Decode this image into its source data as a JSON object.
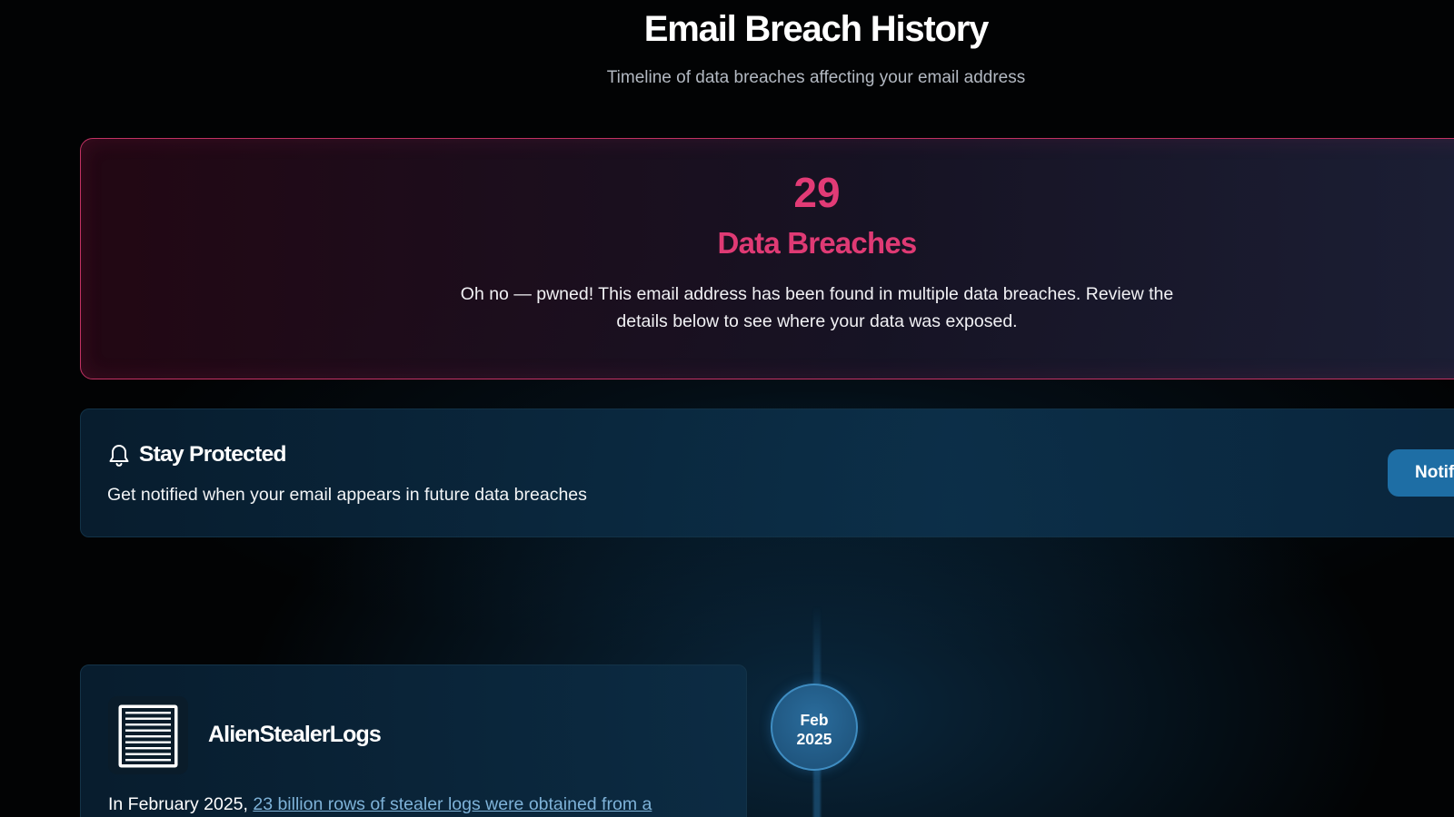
{
  "header": {
    "title": "Email Breach History",
    "subtitle": "Timeline of data breaches affecting your email address"
  },
  "summary": {
    "count": "29",
    "label": "Data Breaches",
    "text": "Oh no — pwned! This email address has been found in multiple data breaches. Review the details below to see where your data was exposed.",
    "accent_color": "#e23b76"
  },
  "protect": {
    "icon": "bell-icon",
    "title": "Stay Protected",
    "text": "Get notified when your email appears in future data breaches",
    "button_label": "Notif"
  },
  "timeline": {
    "items": [
      {
        "name": "AlienStealerLogs",
        "logo_icon": "document-lines-icon",
        "date_month": "Feb",
        "date_year": "2025",
        "desc_prefix": "In February 2025, ",
        "desc_link": "23 billion rows of stealer logs were obtained from a"
      }
    ]
  }
}
